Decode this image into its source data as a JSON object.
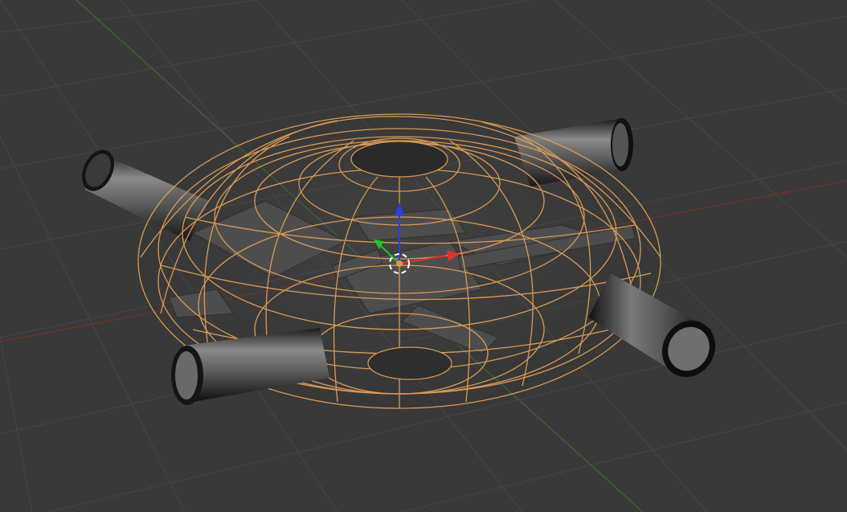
{
  "viewport": {
    "background_color": "#393939",
    "grid_color": "#474747",
    "x_axis_color": "#7a2f2f",
    "y_axis_color": "#3f6a2e",
    "selection_wire_color": "#d99a55",
    "pipe_color": "#7d7d7d",
    "gizmo": {
      "x_arrow_color": "#e03131",
      "y_arrow_color": "#22c42a",
      "z_arrow_color": "#2b3ee8",
      "cursor_icon": "3d-cursor-icon"
    },
    "objects": [
      "dome-wireframe",
      "pipe-left",
      "pipe-right",
      "pipe-front-left",
      "pipe-front-right",
      "inner-frame-structure"
    ]
  }
}
